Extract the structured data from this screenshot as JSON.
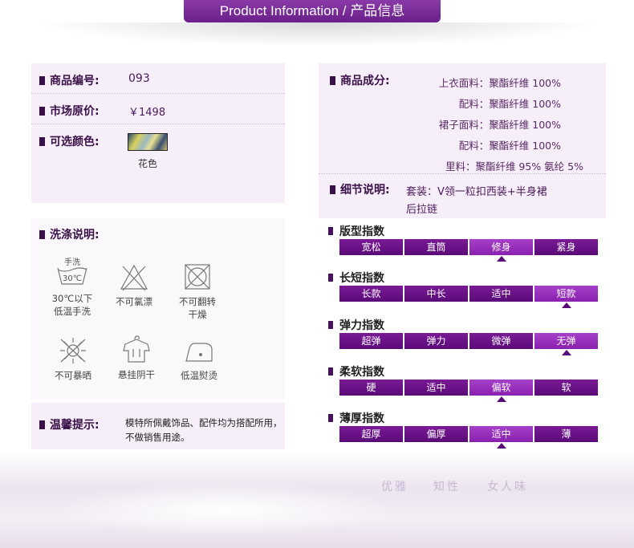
{
  "header": {
    "title": "Product Information / 产品信息"
  },
  "basic": {
    "code_label": "商品编号:",
    "code_value": "093",
    "price_label": "市场原价:",
    "price_value": "￥1498",
    "color_label": "可选颜色:",
    "color_name": "花色"
  },
  "composition": {
    "label": "商品成分:",
    "lines": [
      "上衣面料：聚酯纤维 100%",
      "配料：聚酯纤维 100%",
      "裙子面料：聚酯纤维 100%",
      "配料：聚酯纤维 100%",
      "里料：聚酯纤维 95%  氨纶 5%"
    ]
  },
  "details": {
    "label": "细节说明:",
    "line1": "套装：V领一粒扣西装+半身裙",
    "line2": "后拉链"
  },
  "care": {
    "label": "洗涤说明:",
    "items": [
      {
        "icon": "hand-wash-30-icon",
        "text1": "30℃以下",
        "text2": "低温手洗",
        "icon_text1": "手洗",
        "icon_text2": "30℃"
      },
      {
        "icon": "no-bleach-icon",
        "text1": "不可氯漂",
        "text2": ""
      },
      {
        "icon": "no-tumble-dry-icon",
        "text1": "不可翻转",
        "text2": "干燥"
      },
      {
        "icon": "no-sun-icon",
        "text1": "不可暴晒",
        "text2": ""
      },
      {
        "icon": "hang-dry-shade-icon",
        "text1": "悬挂阴干",
        "text2": ""
      },
      {
        "icon": "low-iron-icon",
        "text1": "低温熨烫",
        "text2": ""
      }
    ]
  },
  "tips": {
    "label": "温馨提示:",
    "line1": "模特所佩戴饰品、配件均为搭配所用，",
    "line2": "不做销售用途。"
  },
  "indices": [
    {
      "title": "版型指数",
      "options": [
        "宽松",
        "直筒",
        "修身",
        "紧身"
      ],
      "selected": 2
    },
    {
      "title": "长短指数",
      "options": [
        "长款",
        "中长",
        "适中",
        "短款"
      ],
      "selected": 3
    },
    {
      "title": "弹力指数",
      "options": [
        "超弹",
        "弹力",
        "微弹",
        "无弹"
      ],
      "selected": 3
    },
    {
      "title": "柔软指数",
      "options": [
        "硬",
        "适中",
        "偏软",
        "软"
      ],
      "selected": 2
    },
    {
      "title": "薄厚指数",
      "options": [
        "超厚",
        "偏厚",
        "适中",
        "薄"
      ],
      "selected": 2
    }
  ],
  "slogan": [
    "优雅",
    "知性",
    "女人味"
  ],
  "colors": {
    "accent": "#6a1f8a",
    "panel": "#f6eef8",
    "bar_dark": "#5a0a78",
    "bar_light": "#a640c8"
  }
}
